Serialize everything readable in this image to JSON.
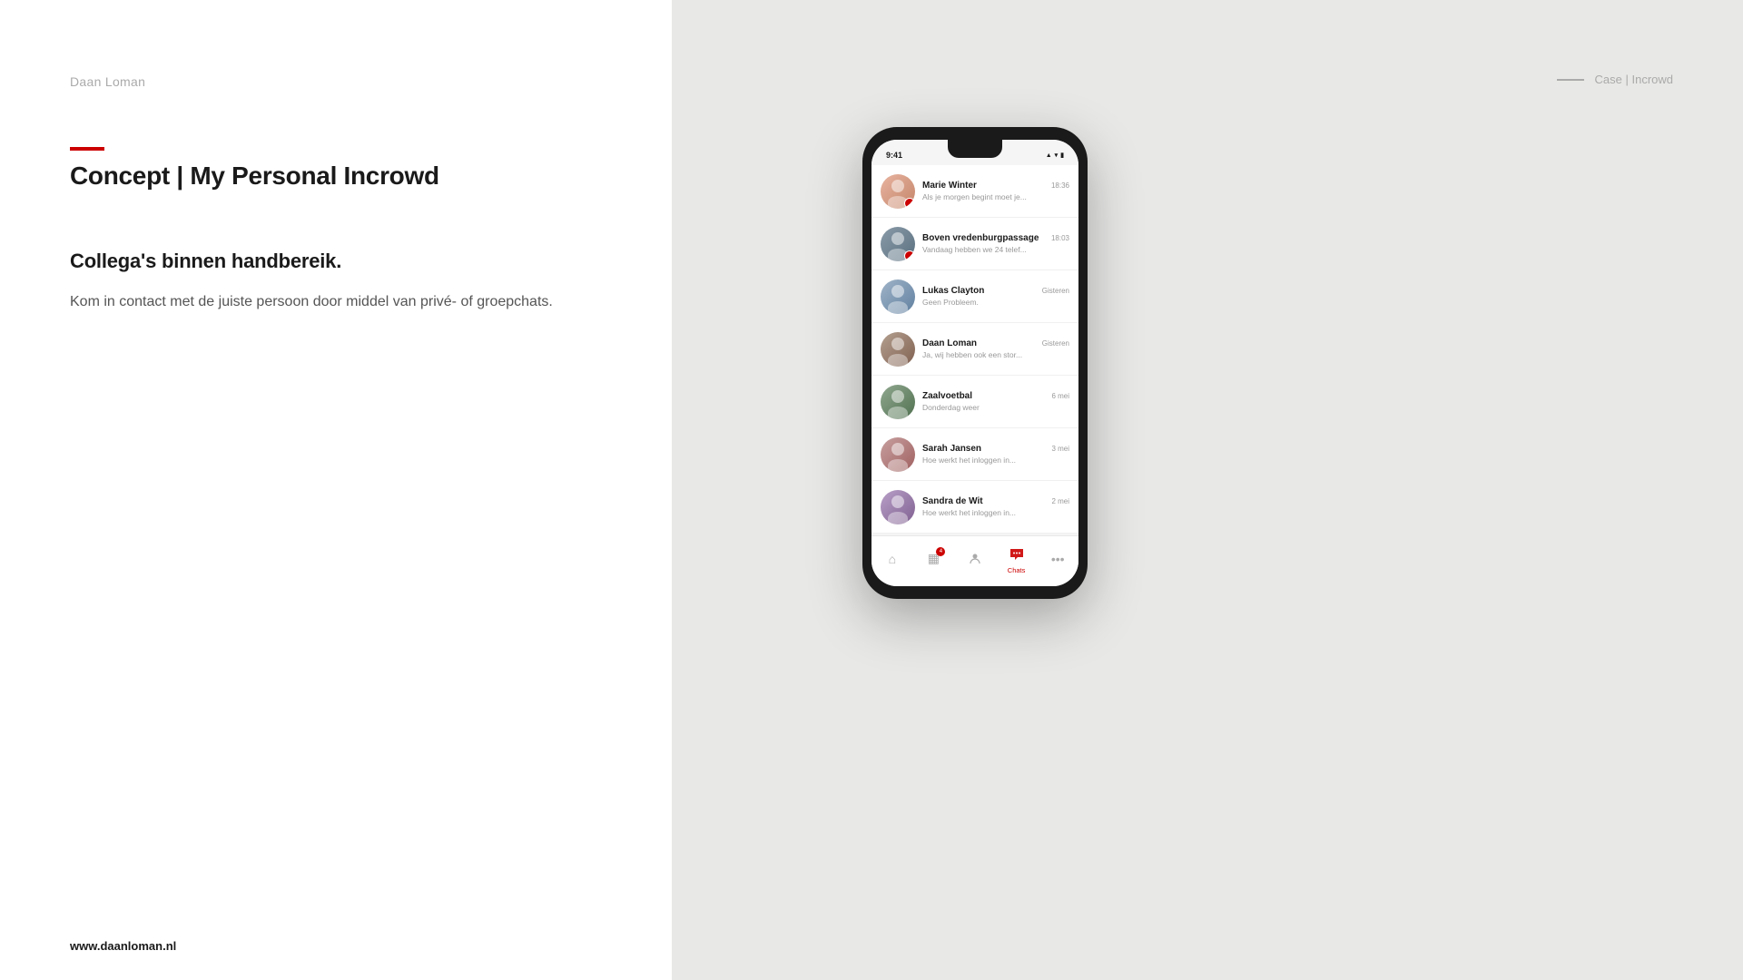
{
  "logo": {
    "text": "Daan Loman"
  },
  "top_right": {
    "dash": "—",
    "label": "Case | Incrowd"
  },
  "content": {
    "accent_line": true,
    "heading": "Concept | My Personal Incrowd",
    "sub_heading": "Collega's binnen handbereik.",
    "body": "Kom in contact met de juiste persoon door middel van privé- of groepchats."
  },
  "footer": {
    "website": "www.daanloman.nl"
  },
  "phone": {
    "status_bar": {
      "time": "9:41",
      "icons": "▲ WiFi Battery"
    },
    "chats": [
      {
        "id": "marie-winter",
        "name": "Marie Winter",
        "preview": "Als je morgen begint moet je...",
        "time": "18:36",
        "has_badge": true,
        "avatar_type": "person",
        "avatar_class": "avatar-marie"
      },
      {
        "id": "boven-vredenburg",
        "name": "Boven vredenburgpassage",
        "preview": "Vandaag hebben we 24 telef...",
        "time": "18:03",
        "has_badge": true,
        "avatar_type": "group",
        "avatar_class": "avatar-boven"
      },
      {
        "id": "lukas-clayton",
        "name": "Lukas Clayton",
        "preview": "Geen Probleem.",
        "time": "Gisteren",
        "has_badge": false,
        "avatar_type": "person",
        "avatar_class": "avatar-lukas"
      },
      {
        "id": "daan-loman",
        "name": "Daan Loman",
        "preview": "Ja, wij hebben ook een stor...",
        "time": "Gisteren",
        "has_badge": false,
        "avatar_type": "person",
        "avatar_class": "avatar-daan"
      },
      {
        "id": "zaalvoetbal",
        "name": "Zaalvoetbal",
        "preview": "Donderdag weer",
        "time": "6 mei",
        "has_badge": false,
        "avatar_type": "group",
        "avatar_class": "avatar-zaal"
      },
      {
        "id": "sarah-jansen",
        "name": "Sarah Jansen",
        "preview": "Hoe werkt het inloggen in...",
        "time": "3 mei",
        "has_badge": false,
        "avatar_type": "person",
        "avatar_class": "avatar-sarah"
      },
      {
        "id": "sandra-de-wit",
        "name": "Sandra de Wit",
        "preview": "Hoe werkt het inloggen in...",
        "time": "2 mei",
        "has_badge": false,
        "avatar_type": "person",
        "avatar_class": "avatar-sandra"
      }
    ],
    "nav": {
      "items": [
        {
          "id": "home",
          "icon": "⌂",
          "label": "",
          "active": false
        },
        {
          "id": "news",
          "icon": "▦",
          "label": "",
          "active": false,
          "badge": "4"
        },
        {
          "id": "contacts",
          "icon": "👤",
          "label": "",
          "active": false
        },
        {
          "id": "chats",
          "icon": "💬",
          "label": "Chats",
          "active": true
        },
        {
          "id": "more",
          "icon": "⋯",
          "label": "",
          "active": false
        }
      ]
    }
  }
}
